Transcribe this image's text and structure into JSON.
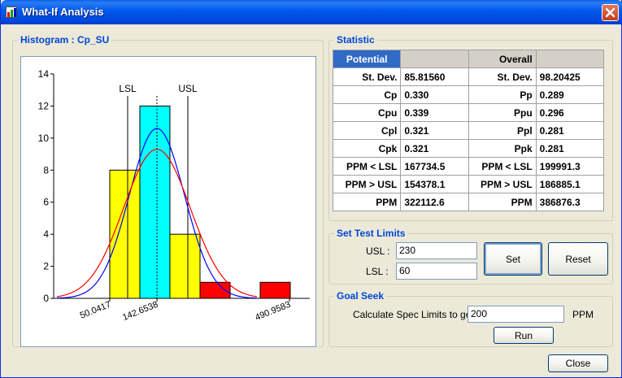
{
  "window": {
    "title": "What-If Analysis"
  },
  "histogram": {
    "group_title": "Histogram : Cp_SU",
    "chart_data": {
      "type": "bar",
      "title": "",
      "ylim": [
        0,
        14
      ],
      "y_ticks": [
        "0",
        "2",
        "4",
        "6",
        "8",
        "10",
        "12",
        "14"
      ],
      "x_tick_labels": [
        "50.0417",
        "142.6538",
        "490.9583"
      ],
      "bins": [
        {
          "value": 8,
          "color": "#ffff00"
        },
        {
          "value": 12,
          "color": "#00ffff"
        },
        {
          "value": 4,
          "color": "#ffff00"
        },
        {
          "value": 1,
          "color": "#ff0000"
        },
        {
          "value": 0,
          "color": "#ff0000"
        },
        {
          "value": 1,
          "color": "#ff0000"
        }
      ],
      "lsl_label": "LSL",
      "usl_label": "USL",
      "curves": [
        {
          "name": "potential",
          "color": "#0000ff"
        },
        {
          "name": "overall",
          "color": "#ff0000"
        }
      ]
    }
  },
  "statistic": {
    "group_title": "Statistic",
    "header": {
      "potential": "Potential",
      "overall": "Overall"
    },
    "rows": [
      {
        "plabel": "St. Dev.",
        "pvalue": "85.81560",
        "olabel": "St. Dev.",
        "ovalue": "98.20425"
      },
      {
        "plabel": "Cp",
        "pvalue": "0.330",
        "olabel": "Pp",
        "ovalue": "0.289"
      },
      {
        "plabel": "Cpu",
        "pvalue": "0.339",
        "olabel": "Ppu",
        "ovalue": "0.296"
      },
      {
        "plabel": "Cpl",
        "pvalue": "0.321",
        "olabel": "Ppl",
        "ovalue": "0.281"
      },
      {
        "plabel": "Cpk",
        "pvalue": "0.321",
        "olabel": "Ppk",
        "ovalue": "0.281"
      },
      {
        "plabel": "PPM < LSL",
        "pvalue": "167734.5",
        "olabel": "PPM < LSL",
        "ovalue": "199991.3"
      },
      {
        "plabel": "PPM > USL",
        "pvalue": "154378.1",
        "olabel": "PPM > USL",
        "ovalue": "186885.1"
      },
      {
        "plabel": "PPM",
        "pvalue": "322112.6",
        "olabel": "PPM",
        "ovalue": "386876.3"
      }
    ]
  },
  "limits": {
    "group_title": "Set Test Limits",
    "usl_label": "USL :",
    "usl_value": "230",
    "lsl_label": "LSL :",
    "lsl_value": "60",
    "set_label": "Set",
    "reset_label": "Reset"
  },
  "goal": {
    "group_title": "Goal Seek",
    "prompt": "Calculate Spec Limits to get",
    "value": "200",
    "unit": "PPM",
    "run_label": "Run"
  },
  "close_label": "Close"
}
